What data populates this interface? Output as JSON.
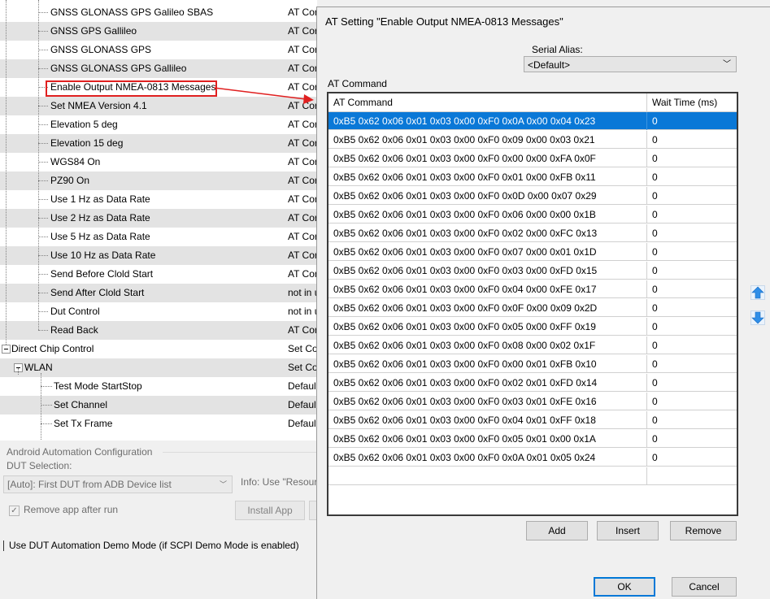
{
  "tree": {
    "rows": [
      {
        "label": "GNSS GLONASS GPS Galileo SBAS",
        "col2": "AT Cor",
        "level": 3
      },
      {
        "label": "GNSS GPS Gallileo",
        "col2": "AT Cor",
        "level": 3
      },
      {
        "label": "GNSS GLONASS GPS",
        "col2": "AT Cor",
        "level": 3
      },
      {
        "label": "GNSS GLONASS GPS Gallileo",
        "col2": "AT Cor",
        "level": 3
      },
      {
        "label": "Enable Output NMEA-0813 Messages",
        "col2": "AT Cor",
        "level": 3
      },
      {
        "label": "Set NMEA Version 4.1",
        "col2": "AT Cor",
        "level": 3
      },
      {
        "label": "Elevation 5 deg",
        "col2": "AT Cor",
        "level": 3
      },
      {
        "label": "Elevation 15 deg",
        "col2": "AT Cor",
        "level": 3
      },
      {
        "label": "WGS84 On",
        "col2": "AT Cor",
        "level": 3
      },
      {
        "label": "PZ90 On",
        "col2": "AT Cor",
        "level": 3
      },
      {
        "label": "Use 1 Hz as Data Rate",
        "col2": "AT Cor",
        "level": 3
      },
      {
        "label": "Use 2 Hz as Data Rate",
        "col2": "AT Cor",
        "level": 3
      },
      {
        "label": "Use 5 Hz as Data Rate",
        "col2": "AT Cor",
        "level": 3
      },
      {
        "label": "Use 10 Hz as Data Rate",
        "col2": "AT Cor",
        "level": 3
      },
      {
        "label": "Send Before Clold Start",
        "col2": "AT Cor",
        "level": 3
      },
      {
        "label": "Send After Clold Start",
        "col2": "not in u",
        "level": 3
      },
      {
        "label": "Dut Control",
        "col2": "not in u",
        "level": 3
      },
      {
        "label": "Read Back",
        "col2": "AT Cor",
        "level": 3
      },
      {
        "label": "Direct Chip Control",
        "col2": "Set Co",
        "level": 1
      },
      {
        "label": "WLAN",
        "col2": "Set Co",
        "level": 2
      },
      {
        "label": "Test Mode StartStop",
        "col2": "Default",
        "level": 4
      },
      {
        "label": "Set Channel",
        "col2": "Default",
        "level": 4
      },
      {
        "label": "Set Tx Frame",
        "col2": "Default",
        "level": 4
      }
    ]
  },
  "android_config": {
    "group_title": "Android Automation Configuration",
    "dut_selection_label": "DUT Selection:",
    "dut_selection_value": "[Auto]: First DUT from ADB Device list",
    "info_text": "Info: Use \"Resourc",
    "remove_app_label": "Remove app after run",
    "install_app_label": "Install App",
    "demo_mode_label": "Use DUT Automation Demo Mode (if SCPI Demo Mode is enabled)"
  },
  "dialog": {
    "title": "AT Setting \"Enable Output NMEA-0813 Messages\"",
    "serial_alias_label": "Serial Alias:",
    "serial_alias_value": "<Default>",
    "grid_label": "AT Command",
    "columns": [
      "AT Command",
      "Wait Time (ms)"
    ],
    "rows": [
      {
        "cmd": "0xB5 0x62 0x06 0x01 0x03 0x00 0xF0 0x0A 0x00 0x04 0x23",
        "wait": "0",
        "selected": true
      },
      {
        "cmd": "0xB5 0x62 0x06 0x01 0x03 0x00 0xF0 0x09 0x00 0x03 0x21",
        "wait": "0"
      },
      {
        "cmd": "0xB5 0x62 0x06 0x01 0x03 0x00 0xF0 0x00 0x00 0xFA 0x0F",
        "wait": "0"
      },
      {
        "cmd": "0xB5 0x62 0x06 0x01 0x03 0x00 0xF0 0x01 0x00 0xFB 0x11",
        "wait": "0"
      },
      {
        "cmd": "0xB5 0x62 0x06 0x01 0x03 0x00 0xF0 0x0D 0x00 0x07 0x29",
        "wait": "0"
      },
      {
        "cmd": "0xB5 0x62 0x06 0x01 0x03 0x00 0xF0 0x06 0x00 0x00 0x1B",
        "wait": "0"
      },
      {
        "cmd": "0xB5 0x62 0x06 0x01 0x03 0x00 0xF0 0x02 0x00 0xFC 0x13",
        "wait": "0"
      },
      {
        "cmd": "0xB5 0x62 0x06 0x01 0x03 0x00 0xF0 0x07 0x00 0x01 0x1D",
        "wait": "0"
      },
      {
        "cmd": "0xB5 0x62 0x06 0x01 0x03 0x00 0xF0 0x03 0x00 0xFD 0x15",
        "wait": "0"
      },
      {
        "cmd": "0xB5 0x62 0x06 0x01 0x03 0x00 0xF0 0x04 0x00 0xFE 0x17",
        "wait": "0"
      },
      {
        "cmd": "0xB5 0x62 0x06 0x01 0x03 0x00 0xF0 0x0F 0x00 0x09 0x2D",
        "wait": "0"
      },
      {
        "cmd": "0xB5 0x62 0x06 0x01 0x03 0x00 0xF0 0x05 0x00 0xFF 0x19",
        "wait": "0"
      },
      {
        "cmd": "0xB5 0x62 0x06 0x01 0x03 0x00 0xF0 0x08 0x00 0x02 0x1F",
        "wait": "0"
      },
      {
        "cmd": "0xB5 0x62 0x06 0x01 0x03 0x00 0xF0 0x00 0x01 0xFB 0x10",
        "wait": "0"
      },
      {
        "cmd": "0xB5 0x62 0x06 0x01 0x03 0x00 0xF0 0x02 0x01 0xFD 0x14",
        "wait": "0"
      },
      {
        "cmd": "0xB5 0x62 0x06 0x01 0x03 0x00 0xF0 0x03 0x01 0xFE 0x16",
        "wait": "0"
      },
      {
        "cmd": "0xB5 0x62 0x06 0x01 0x03 0x00 0xF0 0x04 0x01 0xFF 0x18",
        "wait": "0"
      },
      {
        "cmd": "0xB5 0x62 0x06 0x01 0x03 0x00 0xF0 0x05 0x01 0x00 0x1A",
        "wait": "0"
      },
      {
        "cmd": "0xB5 0x62 0x06 0x01 0x03 0x00 0xF0 0x0A 0x01 0x05 0x24",
        "wait": "0"
      },
      {
        "cmd": "",
        "wait": ""
      }
    ],
    "buttons": {
      "add": "Add",
      "insert": "Insert",
      "remove": "Remove",
      "ok": "OK",
      "cancel": "Cancel"
    }
  },
  "colors": {
    "selection": "#0a78d7",
    "highlight_box": "#e02020",
    "arrow_icons": "#2e8ee8"
  }
}
